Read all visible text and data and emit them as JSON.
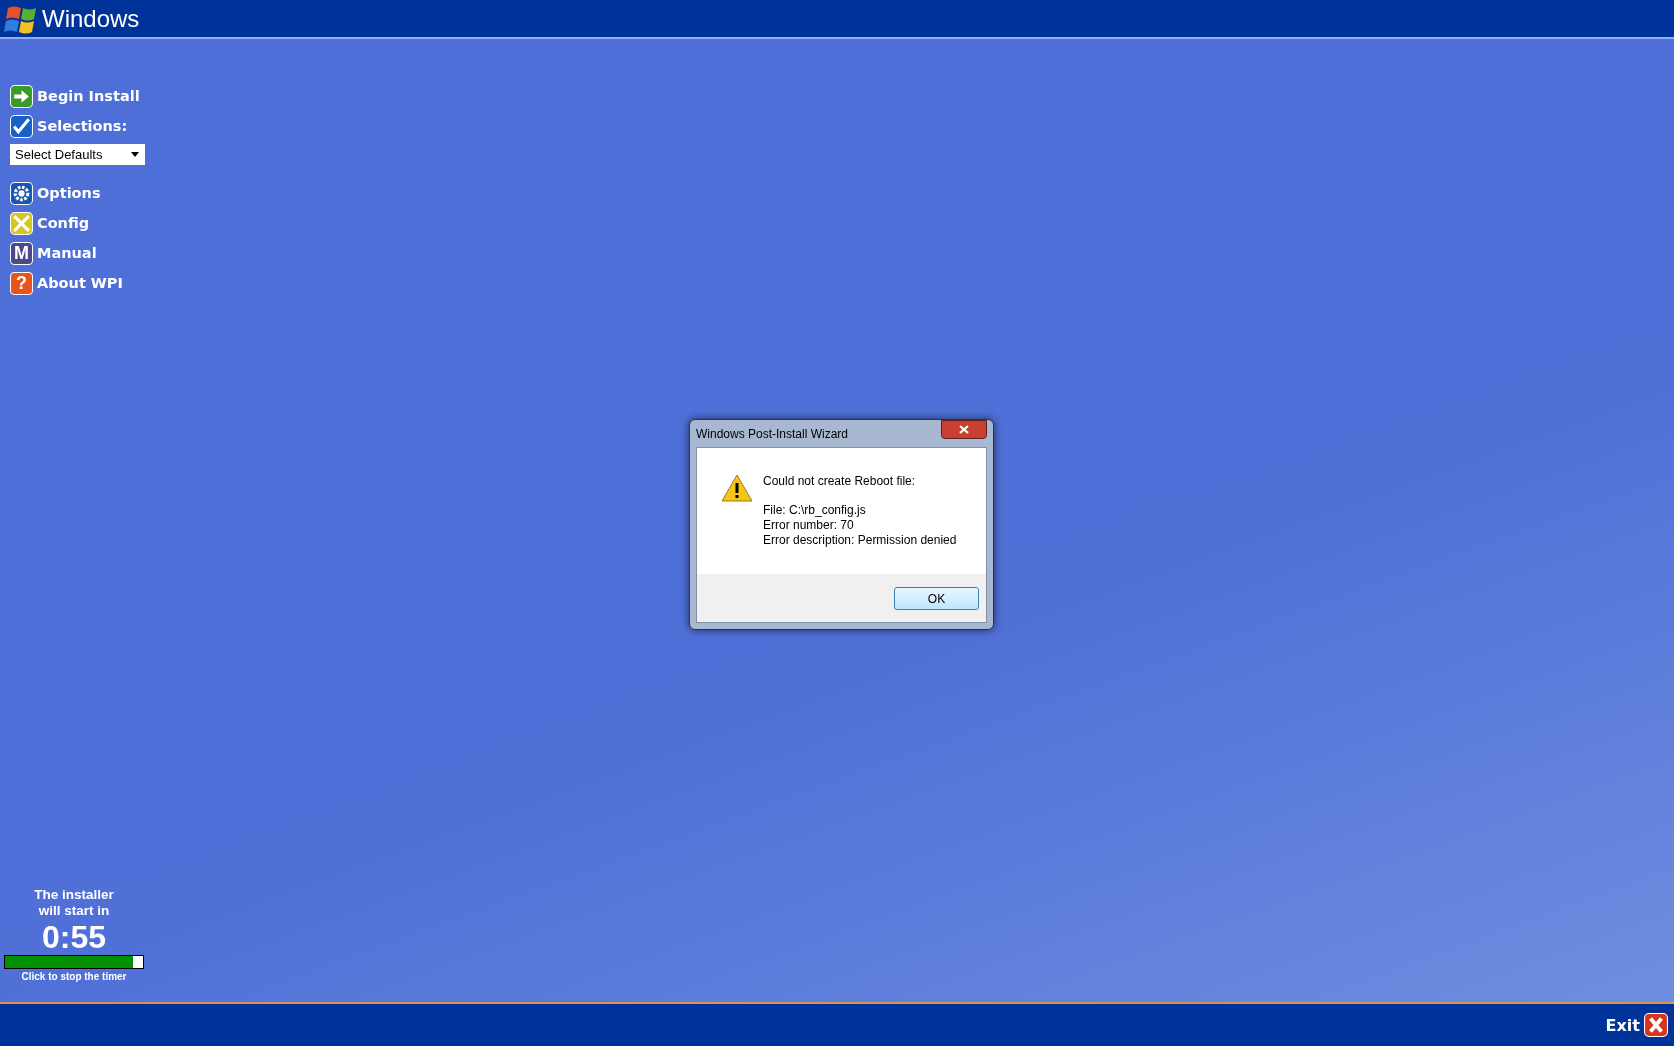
{
  "header": {
    "title": "Windows"
  },
  "menu": [
    {
      "label": "Begin Install",
      "kind": "arrow"
    },
    {
      "label": "Selections:",
      "kind": "check"
    },
    {
      "label": "Options",
      "kind": "gear"
    },
    {
      "label": "Config",
      "kind": "tools"
    },
    {
      "label": "Manual",
      "kind": "letter",
      "icon_text": "M"
    },
    {
      "label": "About WPI",
      "kind": "help",
      "icon_text": "?"
    }
  ],
  "selections_dropdown": {
    "value": "Select Defaults"
  },
  "timer": {
    "message": "The installer will start in",
    "time": "0:55",
    "level": 0.93,
    "hint": "Click to stop the timer"
  },
  "footer": {
    "exit_label": "Exit"
  },
  "dialog": {
    "title": "Windows Post-Install Wizard",
    "heading": "Could not create Reboot file:",
    "lines": [
      "File: C:\\rb_config.js",
      "Error number: 70",
      "Error description: Permission denied"
    ],
    "button": "OK"
  }
}
